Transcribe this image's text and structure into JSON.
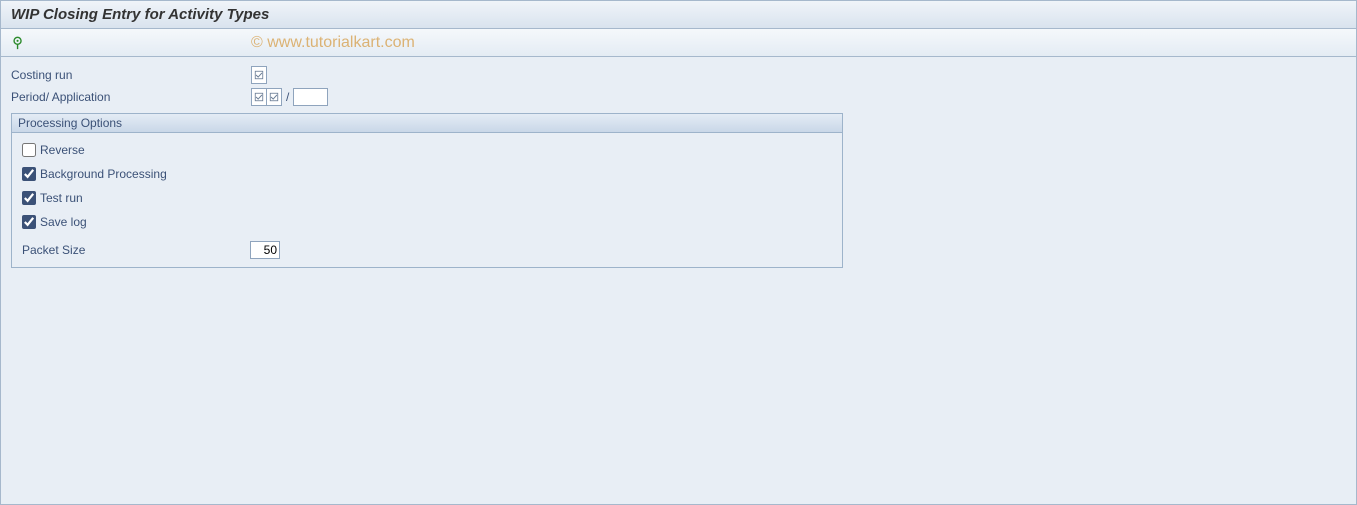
{
  "title": "WIP Closing Entry for Activity Types",
  "watermark": "© www.tutorialkart.com",
  "fields": {
    "costing_run_label": "Costing run",
    "period_app_label": "Period/ Application",
    "period_separator": "/",
    "application_value": ""
  },
  "groupbox": {
    "title": "Processing Options",
    "reverse": {
      "label": "Reverse",
      "checked": false
    },
    "background": {
      "label": "Background Processing",
      "checked": true
    },
    "testrun": {
      "label": "Test run",
      "checked": true
    },
    "savelog": {
      "label": "Save log",
      "checked": true
    },
    "packet_size_label": "Packet Size",
    "packet_size_value": "50"
  }
}
